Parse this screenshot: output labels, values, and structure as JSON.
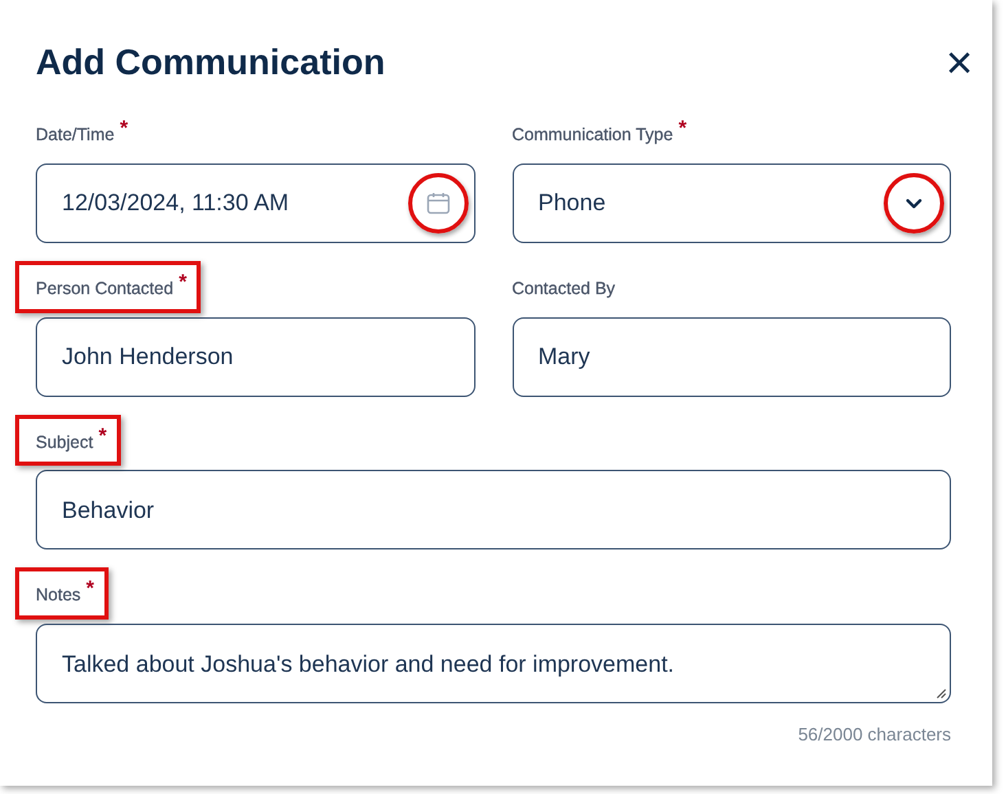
{
  "dialog": {
    "title": "Add Communication",
    "close": "×"
  },
  "rows": [
    {
      "fields": [
        {
          "kind": "date",
          "label": "Date/Time",
          "required_mark": "*",
          "value": "12/03/2024, 11:30 AM",
          "label_highlighted": false,
          "icon_highlighted": true
        },
        {
          "kind": "select",
          "label": "Communication Type",
          "required_mark": "*",
          "value": "Phone",
          "label_highlighted": false,
          "icon_highlighted": true
        }
      ]
    },
    {
      "fields": [
        {
          "kind": "text",
          "label": "Person Contacted",
          "required_mark": "*",
          "value": "John Henderson",
          "label_highlighted": true
        },
        {
          "kind": "text",
          "label": "Contacted By",
          "value": "Mary",
          "label_highlighted": false
        }
      ]
    },
    {
      "fields": [
        {
          "kind": "text",
          "label": "Subject",
          "required_mark": "*",
          "value": "Behavior",
          "label_highlighted": true
        }
      ]
    },
    {
      "fields": [
        {
          "kind": "textarea",
          "label": "Notes",
          "required_mark": "*",
          "value": "Talked about Joshua's behavior and need for improvement.",
          "label_highlighted": true,
          "counter": "56/2000 characters"
        }
      ]
    }
  ]
}
